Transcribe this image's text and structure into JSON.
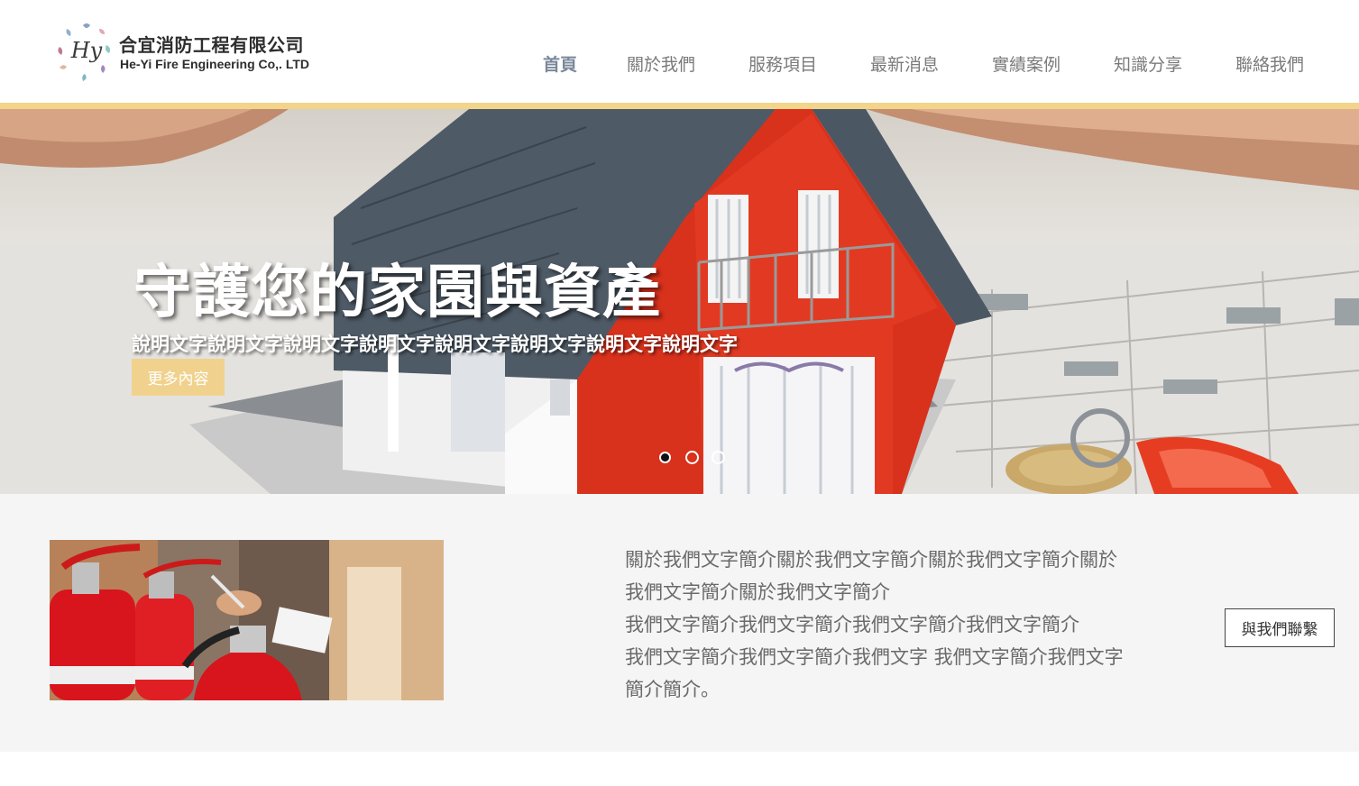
{
  "brand": {
    "name_zh": "合宜消防工程有限公司",
    "name_en": "He-Yi Fire Engineering Co,. LTD",
    "logo_letters": "Hy"
  },
  "nav": {
    "items": [
      {
        "label": "首頁",
        "active": true
      },
      {
        "label": "關於我們",
        "active": false
      },
      {
        "label": "服務項目",
        "active": false
      },
      {
        "label": "最新消息",
        "active": false
      },
      {
        "label": "實績案例",
        "active": false
      },
      {
        "label": "知識分享",
        "active": false
      },
      {
        "label": "聯絡我們",
        "active": false
      }
    ]
  },
  "hero": {
    "title": "守護您的家園與資產",
    "description": "說明文字說明文字說明文字說明文字說明文字說明文字說明文字說明文字",
    "button_label": "更多內容",
    "slide_count": 3,
    "active_slide": 1
  },
  "about": {
    "lines": [
      "關於我們文字簡介關於我們文字簡介關於我們文字簡介關於",
      "我們文字簡介關於我們文字簡介",
      "我們文字簡介我們文字簡介我們文字簡介我們文字簡介",
      "我們文字簡介我們文字簡介我們文字 我們文字簡介我們文字",
      "簡介簡介。"
    ],
    "contact_button_label": "與我們聯繫"
  },
  "colors": {
    "accent_gold": "#f2d48a",
    "button_gold": "#f0d28e",
    "nav_text": "#7b7b7b",
    "nav_active": "#7a8899",
    "section_bg": "#f5f5f5"
  }
}
